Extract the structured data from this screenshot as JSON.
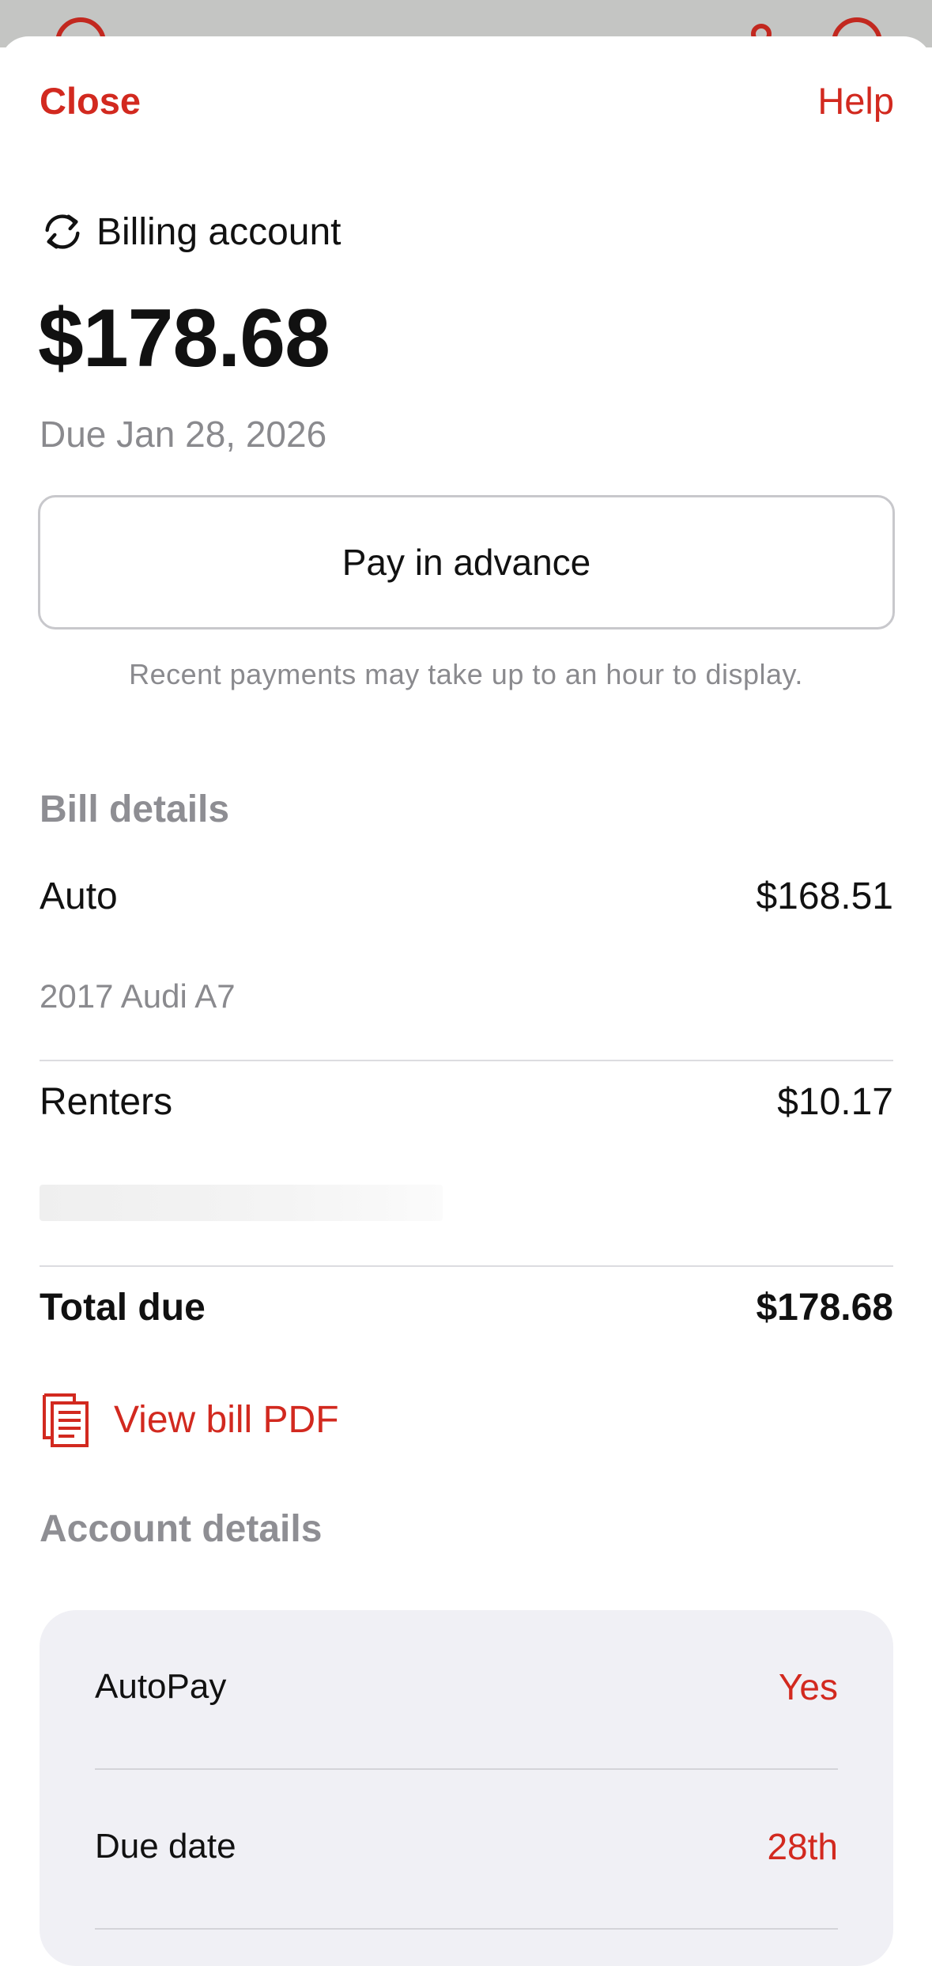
{
  "header": {
    "close_label": "Close",
    "help_label": "Help"
  },
  "account": {
    "title": "Billing account",
    "icon": "refresh-cycle-icon",
    "amount": "$178.68",
    "due": "Due Jan 28, 2026"
  },
  "actions": {
    "pay_label": "Pay in advance",
    "note": "Recent payments may take up to an hour to display."
  },
  "bill_details": {
    "heading": "Bill details",
    "items": [
      {
        "label": "Auto",
        "amount": "$168.51",
        "sub": "2017 Audi A7"
      },
      {
        "label": "Renters",
        "amount": "$10.17",
        "sub": ""
      }
    ],
    "total_label": "Total due",
    "total_amount": "$178.68",
    "pdf_label": "View bill PDF"
  },
  "account_details": {
    "heading": "Account details",
    "autopay_label": "AutoPay",
    "autopay_value": "Yes",
    "due_date_label": "Due date",
    "due_date_value": "28th"
  },
  "colors": {
    "accent": "#d2291f",
    "muted": "#8e8e93",
    "card_bg": "#f0f0f5"
  }
}
